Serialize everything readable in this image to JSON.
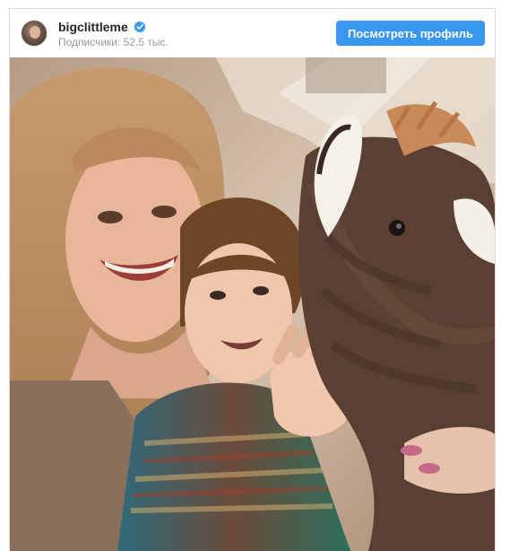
{
  "post": {
    "username": "bigclittleme",
    "verified": true,
    "followers_text": "Подписчики: 52.5 тыс.",
    "view_profile_label": "Посмотреть профиль"
  },
  "icons": {
    "avatar": "profile-avatar",
    "verified": "verified-badge-icon"
  },
  "colors": {
    "button_bg": "#3897f0",
    "button_text": "#ffffff",
    "username": "#262626",
    "secondary_text": "#999999",
    "verified": "#3897f0",
    "border": "#dbdbdb"
  }
}
